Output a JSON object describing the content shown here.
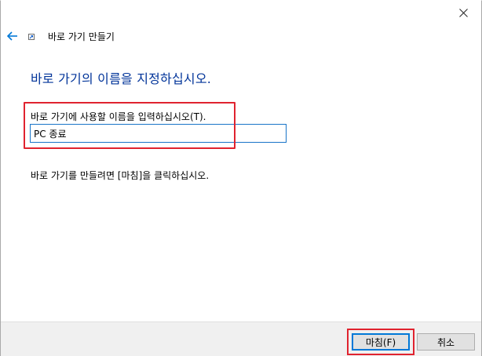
{
  "window": {
    "title": "바로 가기 만들기"
  },
  "header": {
    "back_icon": "back-arrow-icon",
    "app_icon": "shortcut-icon",
    "close_icon": "close-icon"
  },
  "main": {
    "heading": "바로 가기의 이름을 지정하십시오.",
    "field_label": "바로 가기에 사용할 이름을 입력하십시오(T).",
    "name_value": "PC 종료",
    "instruction": "바로 가기를 만들려면 [마침]을 클릭하십시오."
  },
  "footer": {
    "finish_label": "마침(F)",
    "cancel_label": "취소"
  },
  "colors": {
    "heading": "#003399",
    "highlight": "#e0232f",
    "input_border": "#1874c8",
    "back_arrow": "#0078d7"
  }
}
